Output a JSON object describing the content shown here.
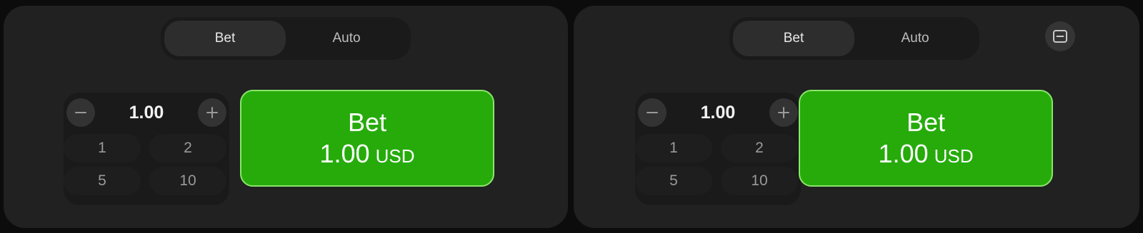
{
  "panels": [
    {
      "tabs": [
        {
          "label": "Bet"
        },
        {
          "label": "Auto"
        }
      ],
      "amount": "1.00",
      "quick_amounts": [
        "1",
        "2",
        "5",
        "10"
      ],
      "bet_button": {
        "label": "Bet",
        "amount": "1.00",
        "currency": "USD"
      }
    },
    {
      "tabs": [
        {
          "label": "Bet"
        },
        {
          "label": "Auto"
        }
      ],
      "amount": "1.00",
      "quick_amounts": [
        "1",
        "2",
        "5",
        "10"
      ],
      "bet_button": {
        "label": "Bet",
        "amount": "1.00",
        "currency": "USD"
      },
      "collapse_icon": "minus-square-icon"
    }
  ],
  "colors": {
    "background": "#0c0c0c",
    "panel": "#212121",
    "bet_green": "#26ab0b",
    "bet_border": "#89e56a"
  }
}
